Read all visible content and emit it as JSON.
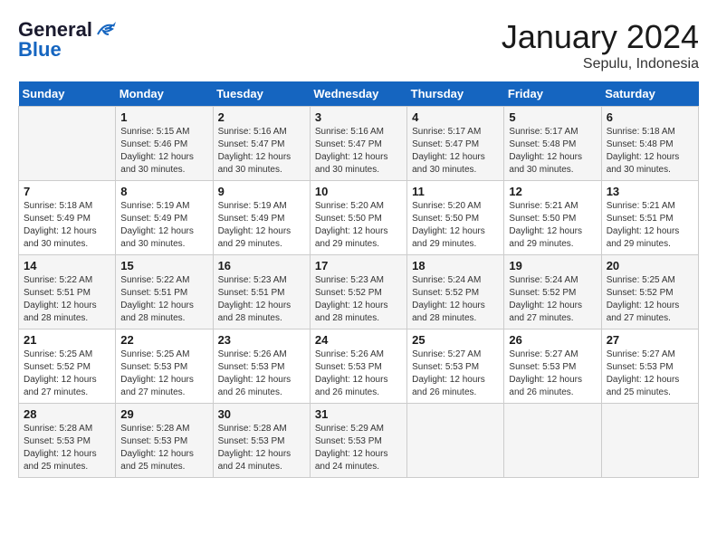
{
  "logo": {
    "line1": "General",
    "line2": "Blue"
  },
  "title": "January 2024",
  "subtitle": "Sepulu, Indonesia",
  "weekdays": [
    "Sunday",
    "Monday",
    "Tuesday",
    "Wednesday",
    "Thursday",
    "Friday",
    "Saturday"
  ],
  "weeks": [
    [
      {
        "day": "",
        "info": ""
      },
      {
        "day": "1",
        "info": "Sunrise: 5:15 AM\nSunset: 5:46 PM\nDaylight: 12 hours\nand 30 minutes."
      },
      {
        "day": "2",
        "info": "Sunrise: 5:16 AM\nSunset: 5:47 PM\nDaylight: 12 hours\nand 30 minutes."
      },
      {
        "day": "3",
        "info": "Sunrise: 5:16 AM\nSunset: 5:47 PM\nDaylight: 12 hours\nand 30 minutes."
      },
      {
        "day": "4",
        "info": "Sunrise: 5:17 AM\nSunset: 5:47 PM\nDaylight: 12 hours\nand 30 minutes."
      },
      {
        "day": "5",
        "info": "Sunrise: 5:17 AM\nSunset: 5:48 PM\nDaylight: 12 hours\nand 30 minutes."
      },
      {
        "day": "6",
        "info": "Sunrise: 5:18 AM\nSunset: 5:48 PM\nDaylight: 12 hours\nand 30 minutes."
      }
    ],
    [
      {
        "day": "7",
        "info": "Sunrise: 5:18 AM\nSunset: 5:49 PM\nDaylight: 12 hours\nand 30 minutes."
      },
      {
        "day": "8",
        "info": "Sunrise: 5:19 AM\nSunset: 5:49 PM\nDaylight: 12 hours\nand 30 minutes."
      },
      {
        "day": "9",
        "info": "Sunrise: 5:19 AM\nSunset: 5:49 PM\nDaylight: 12 hours\nand 29 minutes."
      },
      {
        "day": "10",
        "info": "Sunrise: 5:20 AM\nSunset: 5:50 PM\nDaylight: 12 hours\nand 29 minutes."
      },
      {
        "day": "11",
        "info": "Sunrise: 5:20 AM\nSunset: 5:50 PM\nDaylight: 12 hours\nand 29 minutes."
      },
      {
        "day": "12",
        "info": "Sunrise: 5:21 AM\nSunset: 5:50 PM\nDaylight: 12 hours\nand 29 minutes."
      },
      {
        "day": "13",
        "info": "Sunrise: 5:21 AM\nSunset: 5:51 PM\nDaylight: 12 hours\nand 29 minutes."
      }
    ],
    [
      {
        "day": "14",
        "info": "Sunrise: 5:22 AM\nSunset: 5:51 PM\nDaylight: 12 hours\nand 28 minutes."
      },
      {
        "day": "15",
        "info": "Sunrise: 5:22 AM\nSunset: 5:51 PM\nDaylight: 12 hours\nand 28 minutes."
      },
      {
        "day": "16",
        "info": "Sunrise: 5:23 AM\nSunset: 5:51 PM\nDaylight: 12 hours\nand 28 minutes."
      },
      {
        "day": "17",
        "info": "Sunrise: 5:23 AM\nSunset: 5:52 PM\nDaylight: 12 hours\nand 28 minutes."
      },
      {
        "day": "18",
        "info": "Sunrise: 5:24 AM\nSunset: 5:52 PM\nDaylight: 12 hours\nand 28 minutes."
      },
      {
        "day": "19",
        "info": "Sunrise: 5:24 AM\nSunset: 5:52 PM\nDaylight: 12 hours\nand 27 minutes."
      },
      {
        "day": "20",
        "info": "Sunrise: 5:25 AM\nSunset: 5:52 PM\nDaylight: 12 hours\nand 27 minutes."
      }
    ],
    [
      {
        "day": "21",
        "info": "Sunrise: 5:25 AM\nSunset: 5:52 PM\nDaylight: 12 hours\nand 27 minutes."
      },
      {
        "day": "22",
        "info": "Sunrise: 5:25 AM\nSunset: 5:53 PM\nDaylight: 12 hours\nand 27 minutes."
      },
      {
        "day": "23",
        "info": "Sunrise: 5:26 AM\nSunset: 5:53 PM\nDaylight: 12 hours\nand 26 minutes."
      },
      {
        "day": "24",
        "info": "Sunrise: 5:26 AM\nSunset: 5:53 PM\nDaylight: 12 hours\nand 26 minutes."
      },
      {
        "day": "25",
        "info": "Sunrise: 5:27 AM\nSunset: 5:53 PM\nDaylight: 12 hours\nand 26 minutes."
      },
      {
        "day": "26",
        "info": "Sunrise: 5:27 AM\nSunset: 5:53 PM\nDaylight: 12 hours\nand 26 minutes."
      },
      {
        "day": "27",
        "info": "Sunrise: 5:27 AM\nSunset: 5:53 PM\nDaylight: 12 hours\nand 25 minutes."
      }
    ],
    [
      {
        "day": "28",
        "info": "Sunrise: 5:28 AM\nSunset: 5:53 PM\nDaylight: 12 hours\nand 25 minutes."
      },
      {
        "day": "29",
        "info": "Sunrise: 5:28 AM\nSunset: 5:53 PM\nDaylight: 12 hours\nand 25 minutes."
      },
      {
        "day": "30",
        "info": "Sunrise: 5:28 AM\nSunset: 5:53 PM\nDaylight: 12 hours\nand 24 minutes."
      },
      {
        "day": "31",
        "info": "Sunrise: 5:29 AM\nSunset: 5:53 PM\nDaylight: 12 hours\nand 24 minutes."
      },
      {
        "day": "",
        "info": ""
      },
      {
        "day": "",
        "info": ""
      },
      {
        "day": "",
        "info": ""
      }
    ]
  ]
}
